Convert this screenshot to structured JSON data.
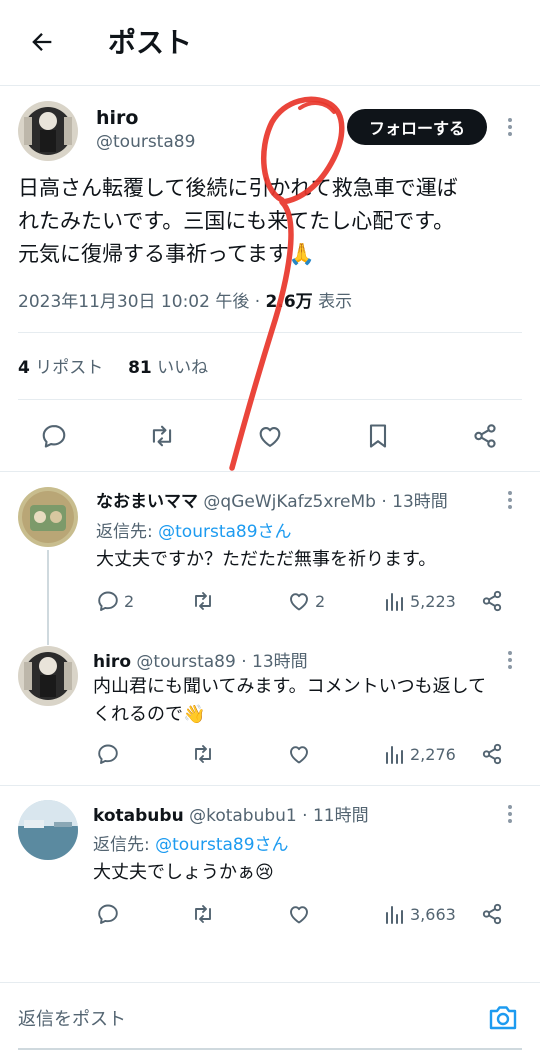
{
  "header": {
    "title": "ポスト",
    "back_icon": "arrow-left-icon"
  },
  "post": {
    "author_name": "hiro",
    "author_handle": "@toursta89",
    "follow_label": "フォローする",
    "text_lines": [
      "日高さん転覆して後続に引かれて救急車で運ば",
      "れたみたいです。三国にも来てたし心配です。",
      "元気に復帰する事祈ってます🙏"
    ],
    "datetime": "2023年11月30日 10:02 午後 · ",
    "views_count": "2.6万",
    "views_label": " 表示",
    "reposts_count": "4",
    "reposts_label": " リポスト",
    "likes_count": "81",
    "likes_label": " いいね"
  },
  "replies": [
    {
      "name": "なおまいママ",
      "handle": "@qGeWjKafz5xreMb",
      "time": " · 13時間",
      "reply_to_prefix": "返信先: ",
      "reply_to": "@toursta89さん",
      "text_lines": [
        "大丈夫ですか？ただただ無事を祈ります。"
      ],
      "reply_count": "2",
      "like_count": "2",
      "views": "5,223"
    },
    {
      "name": "hiro",
      "handle": "@toursta89",
      "time": " · 13時間",
      "text_lines": [
        "内山君にも聞いてみます。コメントいつも返して",
        "くれるので👋"
      ],
      "views": "2,276"
    },
    {
      "name": "kotabubu",
      "handle": "@kotabubu1",
      "time": " · 11時間",
      "reply_to_prefix": "返信先: ",
      "reply_to": "@toursta89さん",
      "text_lines": [
        "大丈夫でしょうかぁ😢"
      ],
      "views": "3,663"
    }
  ],
  "compose": {
    "placeholder": "返信をポスト",
    "camera_icon": "camera-icon"
  },
  "colors": {
    "accent": "#1d9bf0",
    "text": "#0f1419",
    "muted": "#536471",
    "annotation": "#e8352a"
  }
}
